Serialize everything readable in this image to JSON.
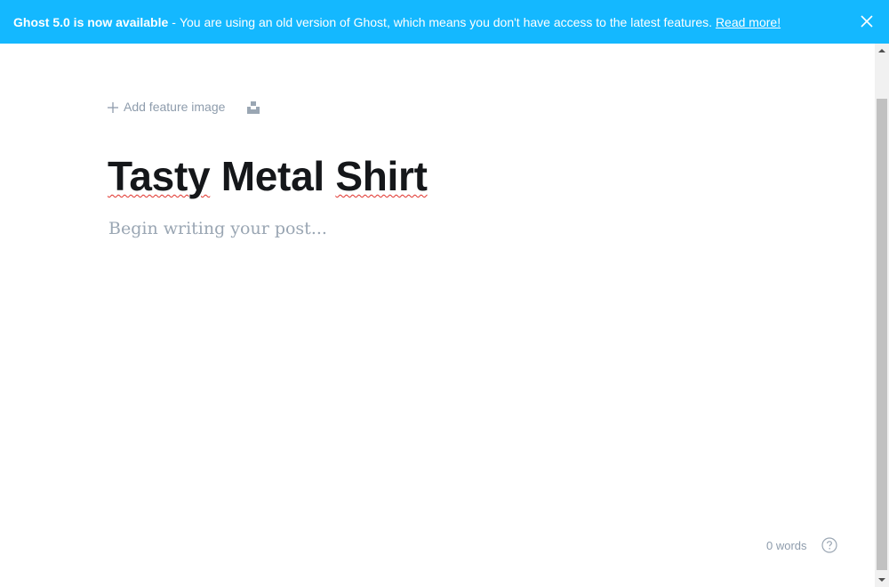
{
  "banner": {
    "title": "Ghost 5.0 is now available",
    "separator": "-",
    "message": "You are using an old version of Ghost, which means you don't have access to the latest features.",
    "link": "Read more!",
    "close_icon": "close-icon",
    "background": "#14b8ff"
  },
  "editor": {
    "add_feature_image": "Add feature image",
    "add_icon": "plus-icon",
    "unsplash_icon": "unsplash-icon",
    "title_words": [
      "Tasty",
      "Metal",
      "Shirt"
    ],
    "body_placeholder": "Begin writing your post...",
    "word_count": "0 words",
    "help_icon": "help-icon"
  },
  "colors": {
    "title": "#15171a",
    "muted": "#8e9cac",
    "spellcheck": "#e0312a"
  }
}
